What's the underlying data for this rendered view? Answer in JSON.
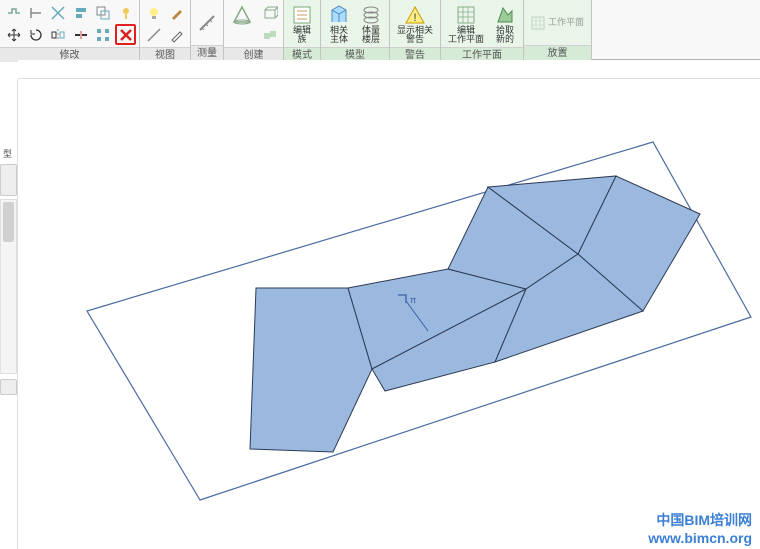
{
  "ribbon": {
    "groups": {
      "modify": {
        "label": "修改"
      },
      "view": {
        "label": "视图"
      },
      "measure": {
        "label": "测量"
      },
      "create": {
        "label": "创建"
      },
      "mode": {
        "label": "模式"
      },
      "model": {
        "label": "模型"
      },
      "warn": {
        "label": "警告"
      },
      "workplane": {
        "label": "工作平面"
      },
      "place": {
        "label": "放置"
      }
    },
    "buttons": {
      "edit_family": "编辑\n族",
      "related_host": "相关\n主体",
      "mass_floors": "体量\n楼层",
      "show_warn": "显示相关\n警告",
      "edit_wp": "编辑\n工作平面",
      "pick_new": "拾取\n新的",
      "workplane_btn": "工作平面"
    }
  },
  "watermark": {
    "line1": "中国BIM培训网",
    "line2": "www.bimcn.org"
  },
  "sidebar": {
    "label": "型"
  }
}
